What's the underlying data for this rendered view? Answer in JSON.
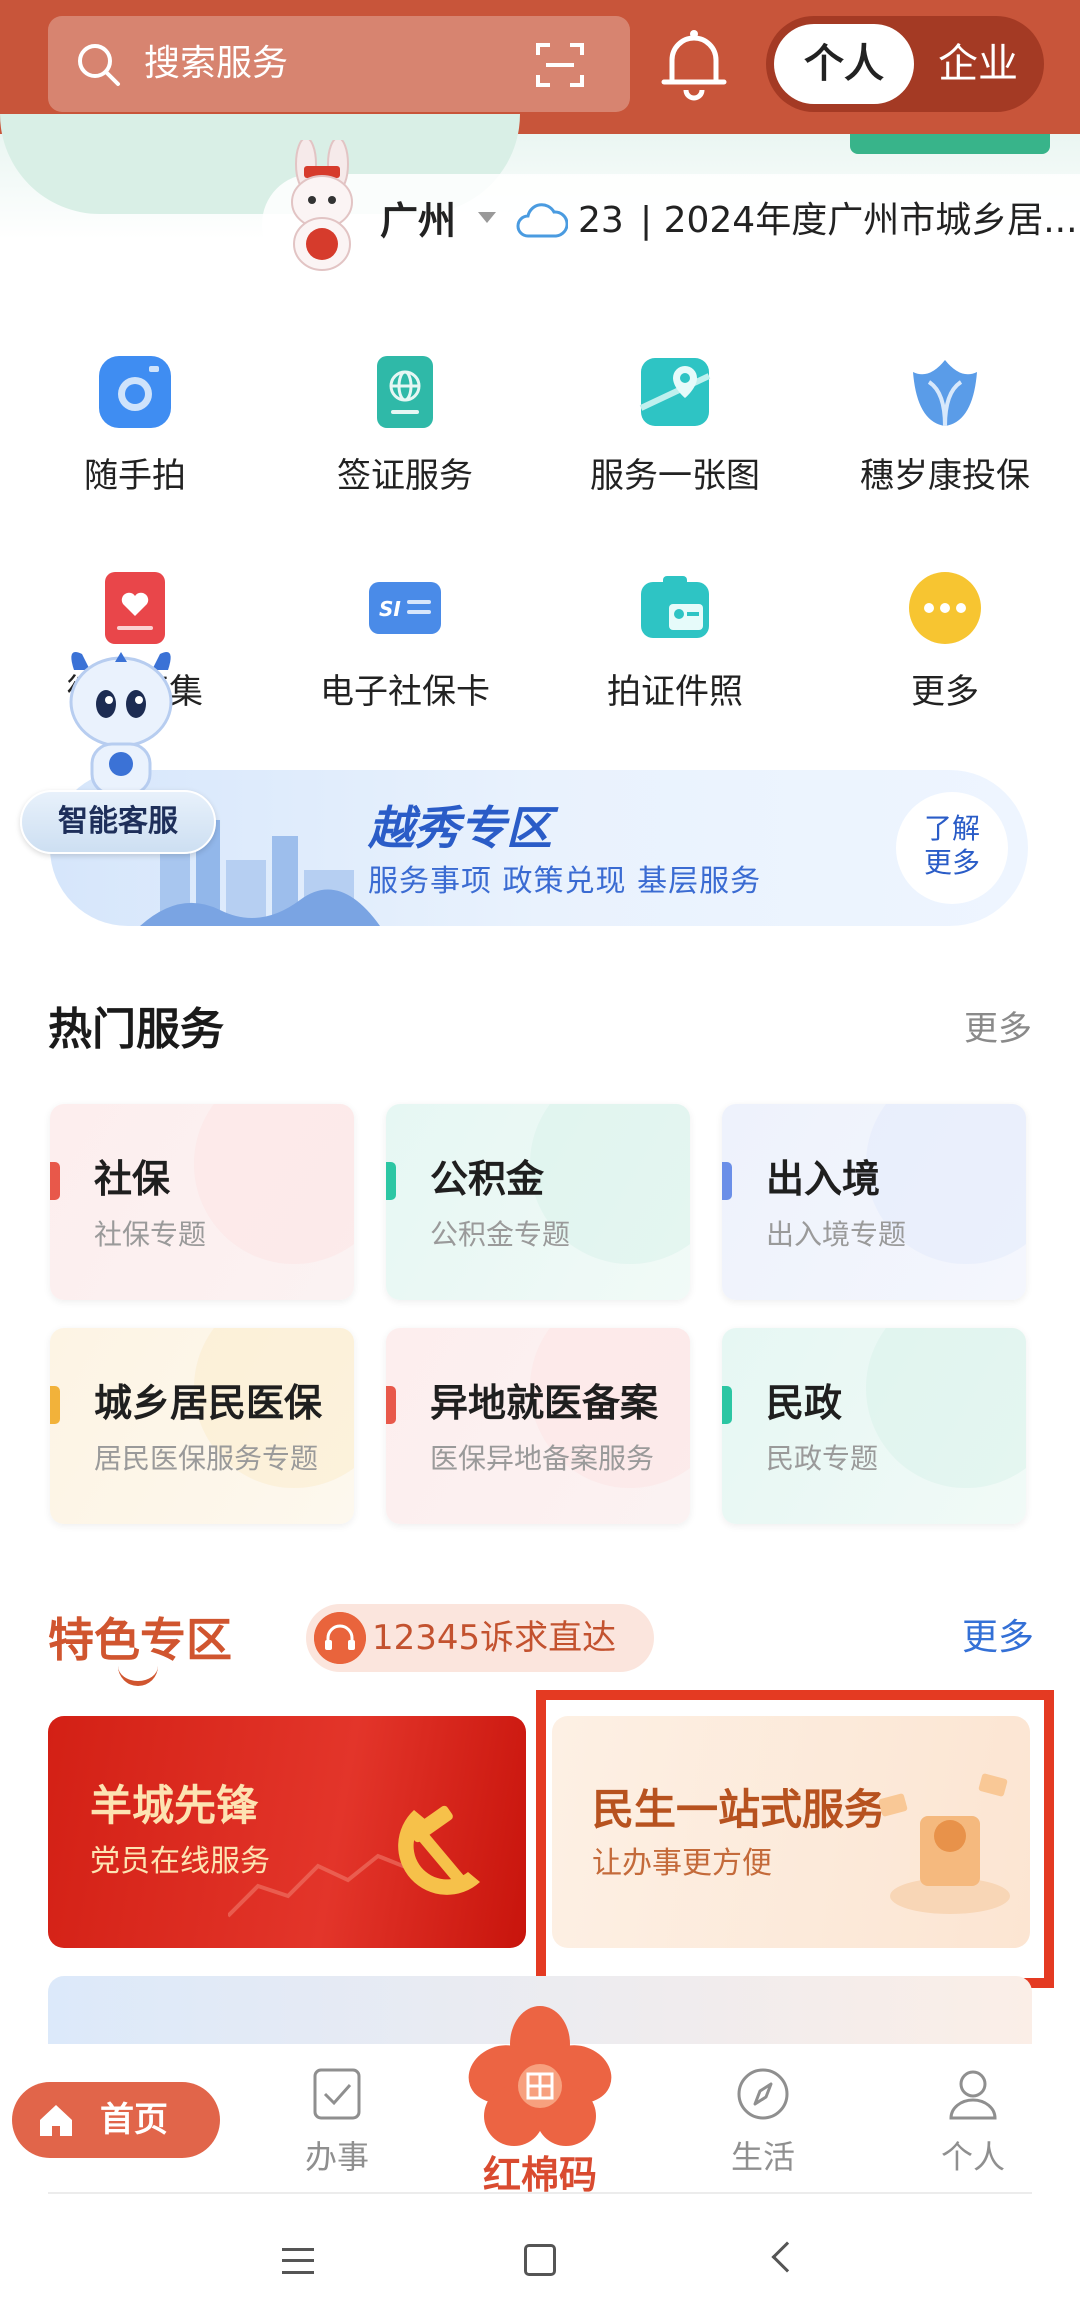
{
  "topbar": {
    "search_placeholder": "搜索服务",
    "toggle_active": "个人",
    "toggle_inactive": "企业",
    "bar_color": "#c8553a"
  },
  "location": {
    "city": "广州",
    "temperature": "23",
    "news": "| 2024年度广州市城乡居..."
  },
  "grid": [
    {
      "label": "随手拍",
      "icon": "camera-icon"
    },
    {
      "label": "签证服务",
      "icon": "passport-icon"
    },
    {
      "label": "服务一张图",
      "icon": "map-icon"
    },
    {
      "label": "穗岁康投保",
      "icon": "tulip-icon"
    },
    {
      "label": "微…征集",
      "icon": "heart-icon"
    },
    {
      "label": "电子社保卡",
      "icon": "social-security-card-icon"
    },
    {
      "label": "拍证件照",
      "icon": "id-photo-icon"
    },
    {
      "label": "更多",
      "icon": "more-dots-icon"
    }
  ],
  "assistant": {
    "label": "智能客服"
  },
  "yuexiu": {
    "title": "越秀专区",
    "subtitle": "服务事项  政策兑现  基层服务",
    "more_line1": "了解",
    "more_line2": "更多"
  },
  "hot_services": {
    "title": "热门服务",
    "more": "更多",
    "items": [
      {
        "title": "社保",
        "subtitle": "社保专题",
        "accent": "#e8584a",
        "bg": "#fdeeee"
      },
      {
        "title": "公积金",
        "subtitle": "公积金专题",
        "accent": "#2cc6a3",
        "bg": "#e8f7f3"
      },
      {
        "title": "出入境",
        "subtitle": "出入境专题",
        "accent": "#6b8fe8",
        "bg": "#eef2fc"
      },
      {
        "title": "城乡居民医保",
        "subtitle": "居民医保服务专题",
        "accent": "#f2b23a",
        "bg": "#fdf5e6"
      },
      {
        "title": "异地就医备案",
        "subtitle": "医保异地备案服务",
        "accent": "#e8584a",
        "bg": "#fdeeee"
      },
      {
        "title": "民政",
        "subtitle": "民政专题",
        "accent": "#2cc6a3",
        "bg": "#e8f7f3"
      }
    ]
  },
  "featured": {
    "title": "特色专区",
    "hotline": "12345诉求直达",
    "more": "更多",
    "red_card": {
      "title": "羊城先锋",
      "subtitle": "党员在线服务"
    },
    "orange_card": {
      "title": "民生一站式服务",
      "subtitle": "让办事更方便"
    }
  },
  "bottom_nav": {
    "home": "首页",
    "work": "办事",
    "center": "红棉码",
    "life": "生活",
    "me": "个人"
  }
}
